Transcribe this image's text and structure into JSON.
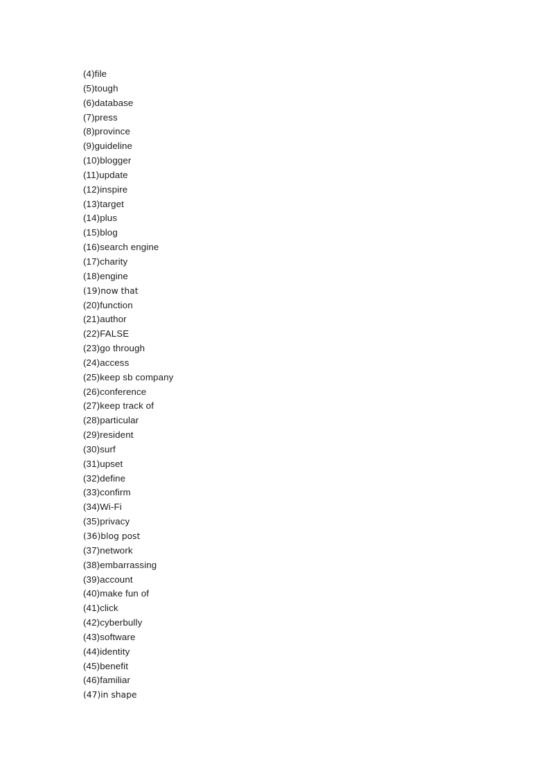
{
  "document": {
    "page_background": "#ffffff",
    "text_color": "#1a1a1a",
    "word_list": [
      {
        "number": "(4)",
        "term": "file",
        "alt_face": false
      },
      {
        "number": "(5)",
        "term": "tough",
        "alt_face": false
      },
      {
        "number": "(6)",
        "term": "database",
        "alt_face": false
      },
      {
        "number": "(7)",
        "term": "press",
        "alt_face": false
      },
      {
        "number": "(8)",
        "term": "province",
        "alt_face": false
      },
      {
        "number": "(9)",
        "term": "guideline",
        "alt_face": false
      },
      {
        "number": "(10)",
        "term": "blogger",
        "alt_face": false
      },
      {
        "number": "(11)",
        "term": "update",
        "alt_face": false
      },
      {
        "number": "(12)",
        "term": "inspire",
        "alt_face": false
      },
      {
        "number": "(13)",
        "term": "target",
        "alt_face": false
      },
      {
        "number": "(14)",
        "term": "plus",
        "alt_face": false
      },
      {
        "number": "(15)",
        "term": "blog",
        "alt_face": false
      },
      {
        "number": "(16)",
        "term": "search engine",
        "alt_face": false
      },
      {
        "number": "(17)",
        "term": "charity",
        "alt_face": false
      },
      {
        "number": "(18)",
        "term": "engine",
        "alt_face": false
      },
      {
        "number": "(19)",
        "term": "now that",
        "alt_face": true
      },
      {
        "number": "(20)",
        "term": "function",
        "alt_face": false
      },
      {
        "number": "(21)",
        "term": "author",
        "alt_face": false
      },
      {
        "number": "(22)",
        "term": "FALSE",
        "alt_face": false
      },
      {
        "number": "(23)",
        "term": "go through",
        "alt_face": false
      },
      {
        "number": "(24)",
        "term": "access",
        "alt_face": false
      },
      {
        "number": "(25)",
        "term": "keep sb company",
        "alt_face": false
      },
      {
        "number": "(26)",
        "term": "conference",
        "alt_face": false
      },
      {
        "number": "(27)",
        "term": "keep track of",
        "alt_face": false
      },
      {
        "number": "(28)",
        "term": "particular",
        "alt_face": false
      },
      {
        "number": "(29)",
        "term": "resident",
        "alt_face": false
      },
      {
        "number": "(30)",
        "term": "surf",
        "alt_face": false
      },
      {
        "number": "(31)",
        "term": "upset",
        "alt_face": false
      },
      {
        "number": "(32)",
        "term": "define",
        "alt_face": false
      },
      {
        "number": "(33)",
        "term": "confirm",
        "alt_face": false
      },
      {
        "number": "(34)",
        "term": "Wi-Fi",
        "alt_face": false
      },
      {
        "number": "(35)",
        "term": "privacy",
        "alt_face": false
      },
      {
        "number": "(36)",
        "term": "blog post",
        "alt_face": true
      },
      {
        "number": "(37)",
        "term": "network",
        "alt_face": false
      },
      {
        "number": "(38)",
        "term": "embarrassing",
        "alt_face": false
      },
      {
        "number": "(39)",
        "term": "account",
        "alt_face": false
      },
      {
        "number": "(40)",
        "term": "make fun of",
        "alt_face": false
      },
      {
        "number": "(41)",
        "term": "click",
        "alt_face": false
      },
      {
        "number": "(42)",
        "term": "cyberbully",
        "alt_face": false
      },
      {
        "number": "(43)",
        "term": "software",
        "alt_face": false
      },
      {
        "number": "(44)",
        "term": "identity",
        "alt_face": false
      },
      {
        "number": "(45)",
        "term": "benefit",
        "alt_face": false
      },
      {
        "number": "(46)",
        "term": "familiar",
        "alt_face": false
      },
      {
        "number": "(47)",
        "term": "in shape",
        "alt_face": true
      }
    ]
  }
}
